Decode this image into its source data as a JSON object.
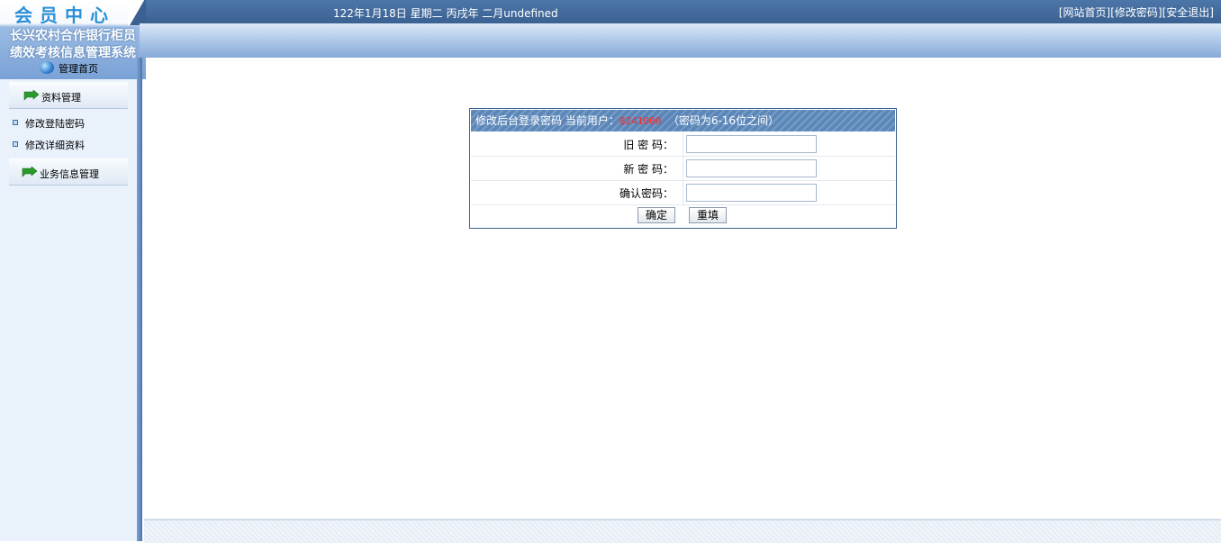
{
  "header": {
    "logo_text": "会员中心",
    "system_title_line1": "长兴农村合作银行柜员",
    "system_title_line2": "绩效考核信息管理系统",
    "date_text": "122年1月18日 星期二 丙戌年 二月undefined",
    "links": [
      "[网站首页]",
      "[修改密码]",
      "[安全退出]"
    ]
  },
  "sidebar": {
    "home_label": "管理首页",
    "sections": [
      {
        "label": "资料管理",
        "items": [
          "修改登陆密码",
          "修改详细资料"
        ]
      },
      {
        "label": "业务信息管理",
        "items": []
      }
    ]
  },
  "form": {
    "title_prefix": "修改后台登录密码 当前用户：",
    "current_user": "8241000",
    "title_suffix": "（密码为6-16位之间）",
    "fields": [
      {
        "label": "旧 密 码：",
        "value": ""
      },
      {
        "label": "新 密 码：",
        "value": ""
      },
      {
        "label": "确认密码：",
        "value": ""
      }
    ],
    "submit_label": "确定",
    "reset_label": "重填"
  },
  "colors": {
    "header_blue": "#3a6192",
    "panel_title": "#5a86b8",
    "username": "#ff2a2a",
    "logo": "#2b8fd6"
  }
}
